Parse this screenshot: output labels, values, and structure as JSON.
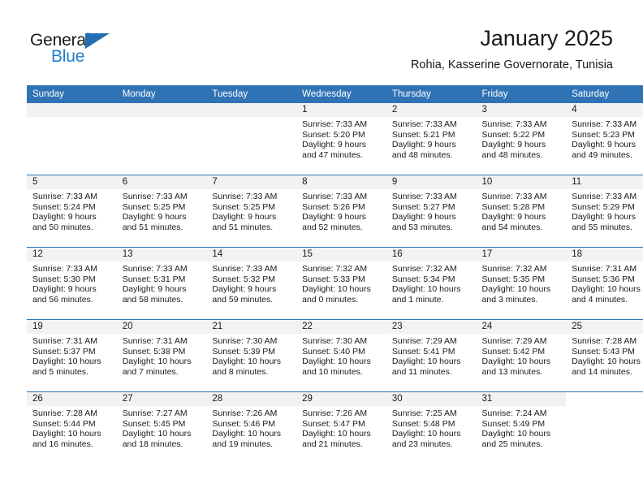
{
  "brand": {
    "name_top": "General",
    "name_bottom": "Blue",
    "accent_color": "#1f7fd0",
    "triangle_color": "#1f6fb2"
  },
  "header": {
    "title": "January 2025",
    "subtitle": "Rohia, Kasserine Governorate, Tunisia"
  },
  "theme": {
    "header_bg": "#3073b5",
    "daynum_bg": "#f2f2f2",
    "text": "#1a1a1a"
  },
  "weekday_headers": [
    "Sunday",
    "Monday",
    "Tuesday",
    "Wednesday",
    "Thursday",
    "Friday",
    "Saturday"
  ],
  "weeks": [
    [
      {
        "day": "",
        "blank": true,
        "void": false
      },
      {
        "day": "",
        "blank": true,
        "void": false
      },
      {
        "day": "",
        "blank": true,
        "void": false
      },
      {
        "day": "1",
        "sunrise": "Sunrise: 7:33 AM",
        "sunset": "Sunset: 5:20 PM",
        "daylight_l1": "Daylight: 9 hours",
        "daylight_l2": "and 47 minutes."
      },
      {
        "day": "2",
        "sunrise": "Sunrise: 7:33 AM",
        "sunset": "Sunset: 5:21 PM",
        "daylight_l1": "Daylight: 9 hours",
        "daylight_l2": "and 48 minutes."
      },
      {
        "day": "3",
        "sunrise": "Sunrise: 7:33 AM",
        "sunset": "Sunset: 5:22 PM",
        "daylight_l1": "Daylight: 9 hours",
        "daylight_l2": "and 48 minutes."
      },
      {
        "day": "4",
        "sunrise": "Sunrise: 7:33 AM",
        "sunset": "Sunset: 5:23 PM",
        "daylight_l1": "Daylight: 9 hours",
        "daylight_l2": "and 49 minutes."
      }
    ],
    [
      {
        "day": "5",
        "sunrise": "Sunrise: 7:33 AM",
        "sunset": "Sunset: 5:24 PM",
        "daylight_l1": "Daylight: 9 hours",
        "daylight_l2": "and 50 minutes."
      },
      {
        "day": "6",
        "sunrise": "Sunrise: 7:33 AM",
        "sunset": "Sunset: 5:25 PM",
        "daylight_l1": "Daylight: 9 hours",
        "daylight_l2": "and 51 minutes."
      },
      {
        "day": "7",
        "sunrise": "Sunrise: 7:33 AM",
        "sunset": "Sunset: 5:25 PM",
        "daylight_l1": "Daylight: 9 hours",
        "daylight_l2": "and 51 minutes."
      },
      {
        "day": "8",
        "sunrise": "Sunrise: 7:33 AM",
        "sunset": "Sunset: 5:26 PM",
        "daylight_l1": "Daylight: 9 hours",
        "daylight_l2": "and 52 minutes."
      },
      {
        "day": "9",
        "sunrise": "Sunrise: 7:33 AM",
        "sunset": "Sunset: 5:27 PM",
        "daylight_l1": "Daylight: 9 hours",
        "daylight_l2": "and 53 minutes."
      },
      {
        "day": "10",
        "sunrise": "Sunrise: 7:33 AM",
        "sunset": "Sunset: 5:28 PM",
        "daylight_l1": "Daylight: 9 hours",
        "daylight_l2": "and 54 minutes."
      },
      {
        "day": "11",
        "sunrise": "Sunrise: 7:33 AM",
        "sunset": "Sunset: 5:29 PM",
        "daylight_l1": "Daylight: 9 hours",
        "daylight_l2": "and 55 minutes."
      }
    ],
    [
      {
        "day": "12",
        "sunrise": "Sunrise: 7:33 AM",
        "sunset": "Sunset: 5:30 PM",
        "daylight_l1": "Daylight: 9 hours",
        "daylight_l2": "and 56 minutes."
      },
      {
        "day": "13",
        "sunrise": "Sunrise: 7:33 AM",
        "sunset": "Sunset: 5:31 PM",
        "daylight_l1": "Daylight: 9 hours",
        "daylight_l2": "and 58 minutes."
      },
      {
        "day": "14",
        "sunrise": "Sunrise: 7:33 AM",
        "sunset": "Sunset: 5:32 PM",
        "daylight_l1": "Daylight: 9 hours",
        "daylight_l2": "and 59 minutes."
      },
      {
        "day": "15",
        "sunrise": "Sunrise: 7:32 AM",
        "sunset": "Sunset: 5:33 PM",
        "daylight_l1": "Daylight: 10 hours",
        "daylight_l2": "and 0 minutes."
      },
      {
        "day": "16",
        "sunrise": "Sunrise: 7:32 AM",
        "sunset": "Sunset: 5:34 PM",
        "daylight_l1": "Daylight: 10 hours",
        "daylight_l2": "and 1 minute."
      },
      {
        "day": "17",
        "sunrise": "Sunrise: 7:32 AM",
        "sunset": "Sunset: 5:35 PM",
        "daylight_l1": "Daylight: 10 hours",
        "daylight_l2": "and 3 minutes."
      },
      {
        "day": "18",
        "sunrise": "Sunrise: 7:31 AM",
        "sunset": "Sunset: 5:36 PM",
        "daylight_l1": "Daylight: 10 hours",
        "daylight_l2": "and 4 minutes."
      }
    ],
    [
      {
        "day": "19",
        "sunrise": "Sunrise: 7:31 AM",
        "sunset": "Sunset: 5:37 PM",
        "daylight_l1": "Daylight: 10 hours",
        "daylight_l2": "and 5 minutes."
      },
      {
        "day": "20",
        "sunrise": "Sunrise: 7:31 AM",
        "sunset": "Sunset: 5:38 PM",
        "daylight_l1": "Daylight: 10 hours",
        "daylight_l2": "and 7 minutes."
      },
      {
        "day": "21",
        "sunrise": "Sunrise: 7:30 AM",
        "sunset": "Sunset: 5:39 PM",
        "daylight_l1": "Daylight: 10 hours",
        "daylight_l2": "and 8 minutes."
      },
      {
        "day": "22",
        "sunrise": "Sunrise: 7:30 AM",
        "sunset": "Sunset: 5:40 PM",
        "daylight_l1": "Daylight: 10 hours",
        "daylight_l2": "and 10 minutes."
      },
      {
        "day": "23",
        "sunrise": "Sunrise: 7:29 AM",
        "sunset": "Sunset: 5:41 PM",
        "daylight_l1": "Daylight: 10 hours",
        "daylight_l2": "and 11 minutes."
      },
      {
        "day": "24",
        "sunrise": "Sunrise: 7:29 AM",
        "sunset": "Sunset: 5:42 PM",
        "daylight_l1": "Daylight: 10 hours",
        "daylight_l2": "and 13 minutes."
      },
      {
        "day": "25",
        "sunrise": "Sunrise: 7:28 AM",
        "sunset": "Sunset: 5:43 PM",
        "daylight_l1": "Daylight: 10 hours",
        "daylight_l2": "and 14 minutes."
      }
    ],
    [
      {
        "day": "26",
        "sunrise": "Sunrise: 7:28 AM",
        "sunset": "Sunset: 5:44 PM",
        "daylight_l1": "Daylight: 10 hours",
        "daylight_l2": "and 16 minutes."
      },
      {
        "day": "27",
        "sunrise": "Sunrise: 7:27 AM",
        "sunset": "Sunset: 5:45 PM",
        "daylight_l1": "Daylight: 10 hours",
        "daylight_l2": "and 18 minutes."
      },
      {
        "day": "28",
        "sunrise": "Sunrise: 7:26 AM",
        "sunset": "Sunset: 5:46 PM",
        "daylight_l1": "Daylight: 10 hours",
        "daylight_l2": "and 19 minutes."
      },
      {
        "day": "29",
        "sunrise": "Sunrise: 7:26 AM",
        "sunset": "Sunset: 5:47 PM",
        "daylight_l1": "Daylight: 10 hours",
        "daylight_l2": "and 21 minutes."
      },
      {
        "day": "30",
        "sunrise": "Sunrise: 7:25 AM",
        "sunset": "Sunset: 5:48 PM",
        "daylight_l1": "Daylight: 10 hours",
        "daylight_l2": "and 23 minutes."
      },
      {
        "day": "31",
        "sunrise": "Sunrise: 7:24 AM",
        "sunset": "Sunset: 5:49 PM",
        "daylight_l1": "Daylight: 10 hours",
        "daylight_l2": "and 25 minutes."
      },
      {
        "day": "",
        "blank": true,
        "void": true
      }
    ]
  ]
}
